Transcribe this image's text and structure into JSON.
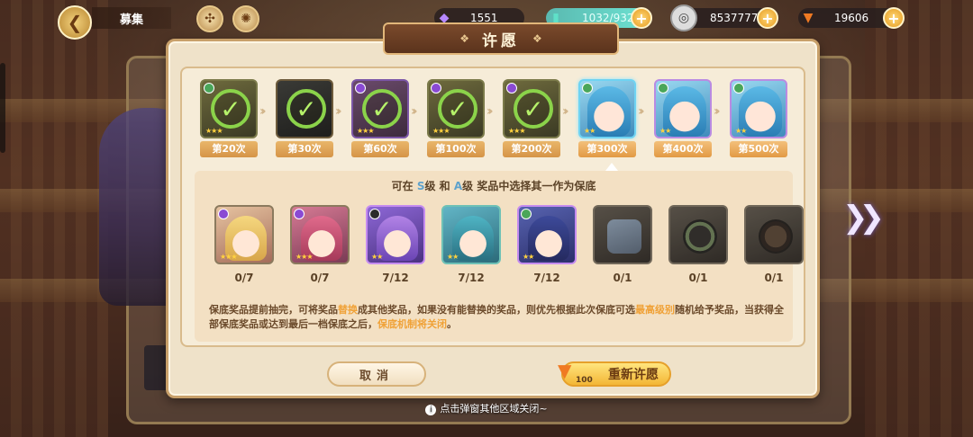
{
  "topbar": {
    "title": "募集",
    "back_icon": "back-arrow-icon",
    "currencies": [
      {
        "name": "gem",
        "value": "1551",
        "icon": "gem-icon"
      },
      {
        "name": "energy",
        "value": "1032/932",
        "icon": "energy-icon"
      },
      {
        "name": "coin",
        "value": "8537777",
        "icon": "coin-icon"
      },
      {
        "name": "carrot",
        "value": "19606",
        "icon": "carrot-icon"
      }
    ]
  },
  "dialog": {
    "title": "许愿",
    "milestones": [
      {
        "label": "第20次",
        "claimed": true
      },
      {
        "label": "第30次",
        "claimed": true
      },
      {
        "label": "第60次",
        "claimed": true
      },
      {
        "label": "第100次",
        "claimed": true
      },
      {
        "label": "第200次",
        "claimed": true
      },
      {
        "label": "第300次",
        "claimed": false,
        "active": true
      },
      {
        "label": "第400次",
        "claimed": false
      },
      {
        "label": "第500次",
        "claimed": false
      }
    ],
    "select_title": {
      "prefix": "可在",
      "grade_s": "S",
      "mid1": "级 和",
      "grade_a": "A",
      "suffix": "级 奖品中选择其一作为保底"
    },
    "rewards": [
      {
        "count": "0/7"
      },
      {
        "count": "0/7"
      },
      {
        "count": "7/12"
      },
      {
        "count": "7/12"
      },
      {
        "count": "7/12"
      },
      {
        "count": "0/1"
      },
      {
        "count": "0/1"
      },
      {
        "count": "0/1"
      }
    ],
    "desc": {
      "p1": "保底奖品提前抽完，可将奖品",
      "hl1": "替换",
      "p2": "成其他奖品，如果没有能替换的奖品，则优先根据此次保底可选",
      "hl2": "最高级别",
      "p3": "随机给予奖品，当获得全部保底奖品或达到最后一档保底之后，",
      "hl3": "保底机制将关闭",
      "p4": "。"
    },
    "cancel_label": "取消",
    "rewish_label": "重新许愿",
    "rewish_cost": "100"
  },
  "hint": "点击弹窗其他区域关闭~"
}
